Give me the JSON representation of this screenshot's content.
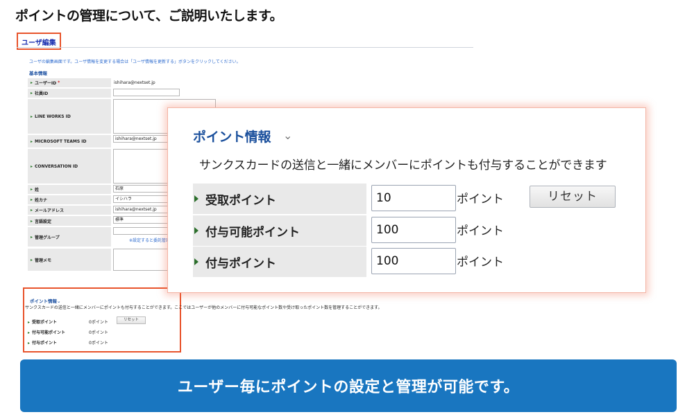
{
  "heading": "ポイントの管理について、ご説明いたします。",
  "screen": {
    "tab_label": "ユーザ編集",
    "intro": "ユーザの編集画面です。ユーザ情報を変更する場合は「ユーザ情報を更新する」ボタンをクリックしてください。",
    "section_basic": "基本情報",
    "fields": {
      "user_id": {
        "label": "ユーザーID",
        "required": "*",
        "value": "ishihara@nextset.jp"
      },
      "employee_id": {
        "label": "社員ID"
      },
      "line_works_id": {
        "label": "LINE WORKS ID"
      },
      "teams_id": {
        "label": "MICROSOFT TEAMS ID",
        "value": "ishihara@nextset.jp"
      },
      "conversation_id": {
        "label": "CONVERSATION ID"
      },
      "last_name": {
        "label": "姓",
        "value": "石原"
      },
      "kana": {
        "label": "姓カナ",
        "value": "イシハラ"
      },
      "email": {
        "label": "メールアドレス",
        "value": "ishihara@nextset.jp"
      },
      "language": {
        "label": "言語設定",
        "value": "標準"
      },
      "group": {
        "label": "管理グループ",
        "note": "※設定すると委託管理者がこ"
      },
      "memo": {
        "label": "管理メモ"
      }
    },
    "points_small": {
      "title": "ポイント情報",
      "chevron": "⌄",
      "description": "サンクスカードの送信と一緒にメンバーにポイントも付与することができます。ここではユーザーが他のメンバーに付与可能なポイント数や受け取ったポイント数を管理することができます。",
      "rows": [
        {
          "label": "受取ポイント",
          "value": "0ポイント"
        },
        {
          "label": "付与可能ポイント",
          "value": "0ポイント"
        },
        {
          "label": "付与ポイント",
          "value": "0ポイント"
        }
      ],
      "reset_label": "リセット"
    }
  },
  "zoom": {
    "title": "ポイント情報",
    "chevron": "⌄",
    "description": "サンクスカードの送信と一緒にメンバーにポイントも付与することができます",
    "unit": "ポイント",
    "reset_label": "リセット",
    "rows": [
      {
        "label": "受取ポイント",
        "value": "10"
      },
      {
        "label": "付与可能ポイント",
        "value": "100"
      },
      {
        "label": "付与ポイント",
        "value": "100"
      }
    ]
  },
  "banner": "ユーザー毎にポイントの設定と管理が可能です。",
  "colors": {
    "accent_red": "#e8532b",
    "banner_blue": "#1976c0",
    "title_blue": "#1a4f9c",
    "marker_green": "#2b6e2b"
  }
}
